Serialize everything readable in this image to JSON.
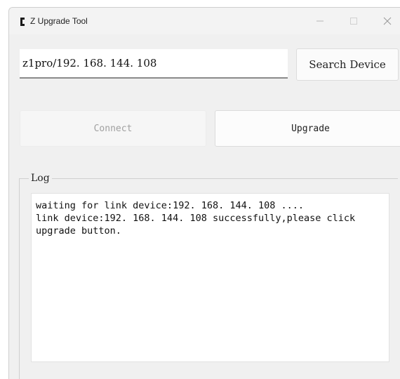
{
  "window": {
    "title": "Z Upgrade Tool",
    "controls": {
      "minimize_icon": "minimize-icon",
      "maximize_icon": "maximize-icon",
      "close_icon": "close-icon"
    }
  },
  "device": {
    "address_value": "z1pro/192. 168. 144. 108",
    "search_label": "Search Device"
  },
  "actions": {
    "connect_label": "Connect",
    "connect_enabled": false,
    "upgrade_label": "Upgrade"
  },
  "log": {
    "label": "Log",
    "lines": [
      "waiting for link device:192. 168. 144. 108 ....",
      "link device:192. 168. 144. 108 successfully,please click",
      "upgrade button."
    ]
  },
  "colors": {
    "window_bg": "#f0f0f0",
    "disabled_text": "#a0a0a0",
    "text": "#222222"
  }
}
